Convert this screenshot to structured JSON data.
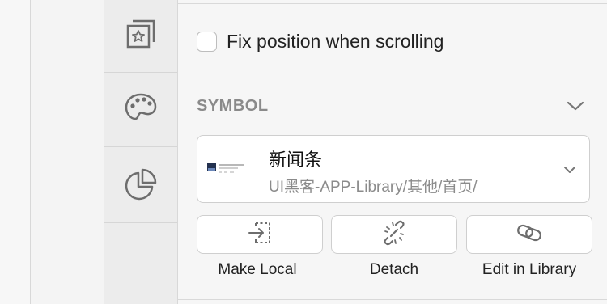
{
  "colors": {
    "panel_bg": "#f6f6f6",
    "rail_bg": "#ececec",
    "card_bg": "#ffffff",
    "border": "#cfcfcf",
    "section_title": "#8a8a8a",
    "muted_text": "#8b8b8b"
  },
  "rail": {
    "items": [
      {
        "icon": "star-frame-icon"
      },
      {
        "icon": "palette-icon"
      },
      {
        "icon": "pie-chart-icon"
      }
    ]
  },
  "fix_position": {
    "label": "Fix position when scrolling",
    "checked": false
  },
  "symbol": {
    "section_title": "SYMBOL",
    "name": "新闻条",
    "path": "UI黑客-APP-Library/其他/首页/",
    "actions": [
      {
        "label": "Make Local",
        "icon": "make-local-icon"
      },
      {
        "label": "Detach",
        "icon": "detach-icon"
      },
      {
        "label": "Edit in Library",
        "icon": "link-icon"
      }
    ]
  }
}
